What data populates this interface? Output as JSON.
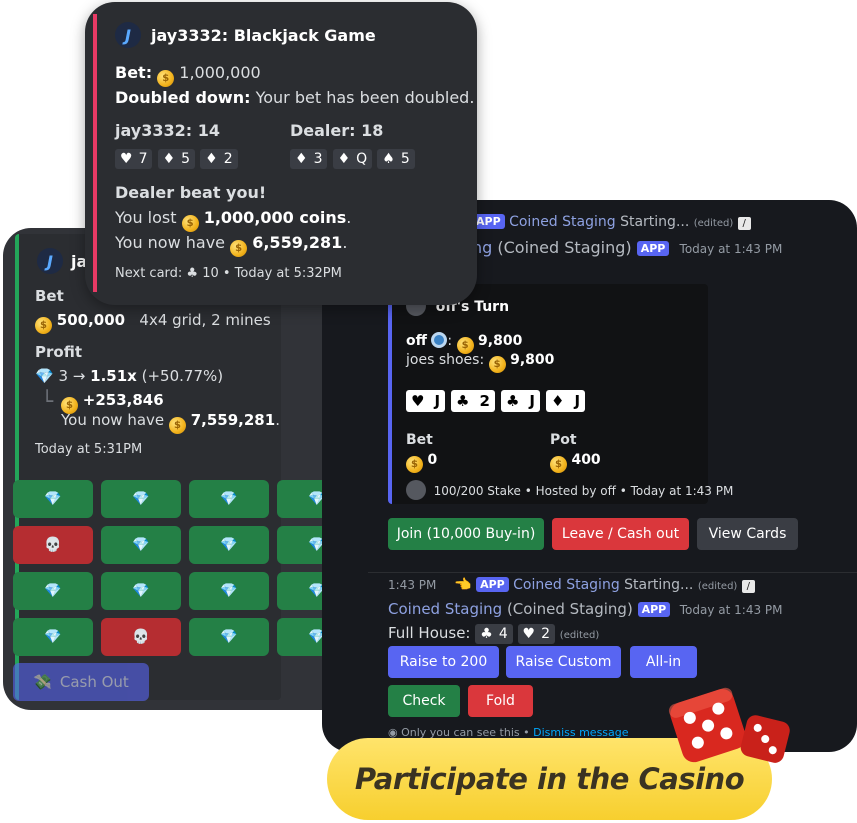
{
  "mines": {
    "header_fragment": "jay",
    "bet_label": "Bet",
    "bet_amount": "500,000",
    "grid_info": "4x4 grid, 2 mines",
    "profit_label": "Profit",
    "gems": "3",
    "arrow": "→",
    "multiplier": "1.51x",
    "multiplier_pct": "(+50.77%)",
    "gain": "+253,846",
    "balance_prefix": "You now have",
    "balance": "7,559,281",
    "balance_suffix": ".",
    "timestamp": "Today at 5:31PM",
    "tiles": [
      "gem",
      "gem",
      "gem",
      "gem",
      "skull",
      "gem",
      "gem",
      "gem",
      "gem",
      "gem",
      "gem",
      "gem",
      "gem",
      "skull",
      "gem",
      "gem"
    ],
    "cashout_label": "Cash Out",
    "accent": "#23a559"
  },
  "blackjack": {
    "title": "jay3332: Blackjack Game",
    "bet_label": "Bet:",
    "bet_amount": "1,000,000",
    "doubled_label": "Doubled down:",
    "doubled_text": "Your bet has been doubled.",
    "player_label": "jay3332: 14",
    "player_cards": [
      {
        "suit": "♥",
        "rank": "7"
      },
      {
        "suit": "♦",
        "rank": "5"
      },
      {
        "suit": "♦",
        "rank": "2"
      }
    ],
    "dealer_label": "Dealer: 18",
    "dealer_cards": [
      {
        "suit": "♦",
        "rank": "3"
      },
      {
        "suit": "♦",
        "rank": "Q"
      },
      {
        "suit": "♠",
        "rank": "5"
      }
    ],
    "result": "Dealer beat you!",
    "lost_prefix": "You lost",
    "lost_amount": "1,000,000 coins",
    "lost_suffix": ".",
    "have_prefix": "You now have",
    "have_amount": "6,559,281",
    "have_suffix": ".",
    "footer": "Next card: ♣ 10 • Today at 5:32PM",
    "accent": "#e83a65"
  },
  "poker": {
    "top_app_badge": "APP",
    "top_bot_name": "Coined Staging",
    "top_starting": "Starting...",
    "top_edited": "(edited)",
    "name_fragment": "ng",
    "name_full": "(Coined Staging)",
    "app_badge": "APP",
    "name_time": "Today at 1:43 PM",
    "turn": "off's Turn",
    "p1_name": "off",
    "p1_colon": ":",
    "p1_chips": "9,800",
    "p2_name": "joes shoes:",
    "p2_chips": "9,800",
    "board_cards": [
      {
        "suit": "♥",
        "rank": "J"
      },
      {
        "suit": "♣",
        "rank": "2"
      },
      {
        "suit": "♣",
        "rank": "J"
      },
      {
        "suit": "♦",
        "rank": "J"
      }
    ],
    "bet_label": "Bet",
    "bet_value": "0",
    "pot_label": "Pot",
    "pot_value": "400",
    "embed_footer": "100/200 Stake • Hosted by off • Today at 1:43 PM",
    "join_label": "Join (10,000 Buy-in)",
    "leave_label": "Leave / Cash out",
    "view_label": "View Cards",
    "reply_time": "1:43 PM",
    "reply_app": "APP",
    "reply_bot": "Coined Staging",
    "reply_starting": "Starting...",
    "reply_edited": "(edited)",
    "msg_name": "Coined Staging",
    "msg_name_full": "(Coined Staging)",
    "msg_app": "APP",
    "msg_time": "Today at 1:43 PM",
    "hand_label": "Full House:",
    "hand_cards": [
      {
        "suit": "♣",
        "rank": "4"
      },
      {
        "suit": "♥",
        "rank": "2"
      }
    ],
    "hand_edited": "(edited)",
    "raise200_label": "Raise to 200",
    "raise_custom_label": "Raise Custom",
    "allin_label": "All-in",
    "check_label": "Check",
    "fold_label": "Fold",
    "ephemeral_text": "Only you can see this •",
    "dismiss_text": "Dismiss message",
    "accent": "#5865f2"
  },
  "banner": {
    "text": "Participate in the Casino",
    "color": "#f7cf2e"
  }
}
